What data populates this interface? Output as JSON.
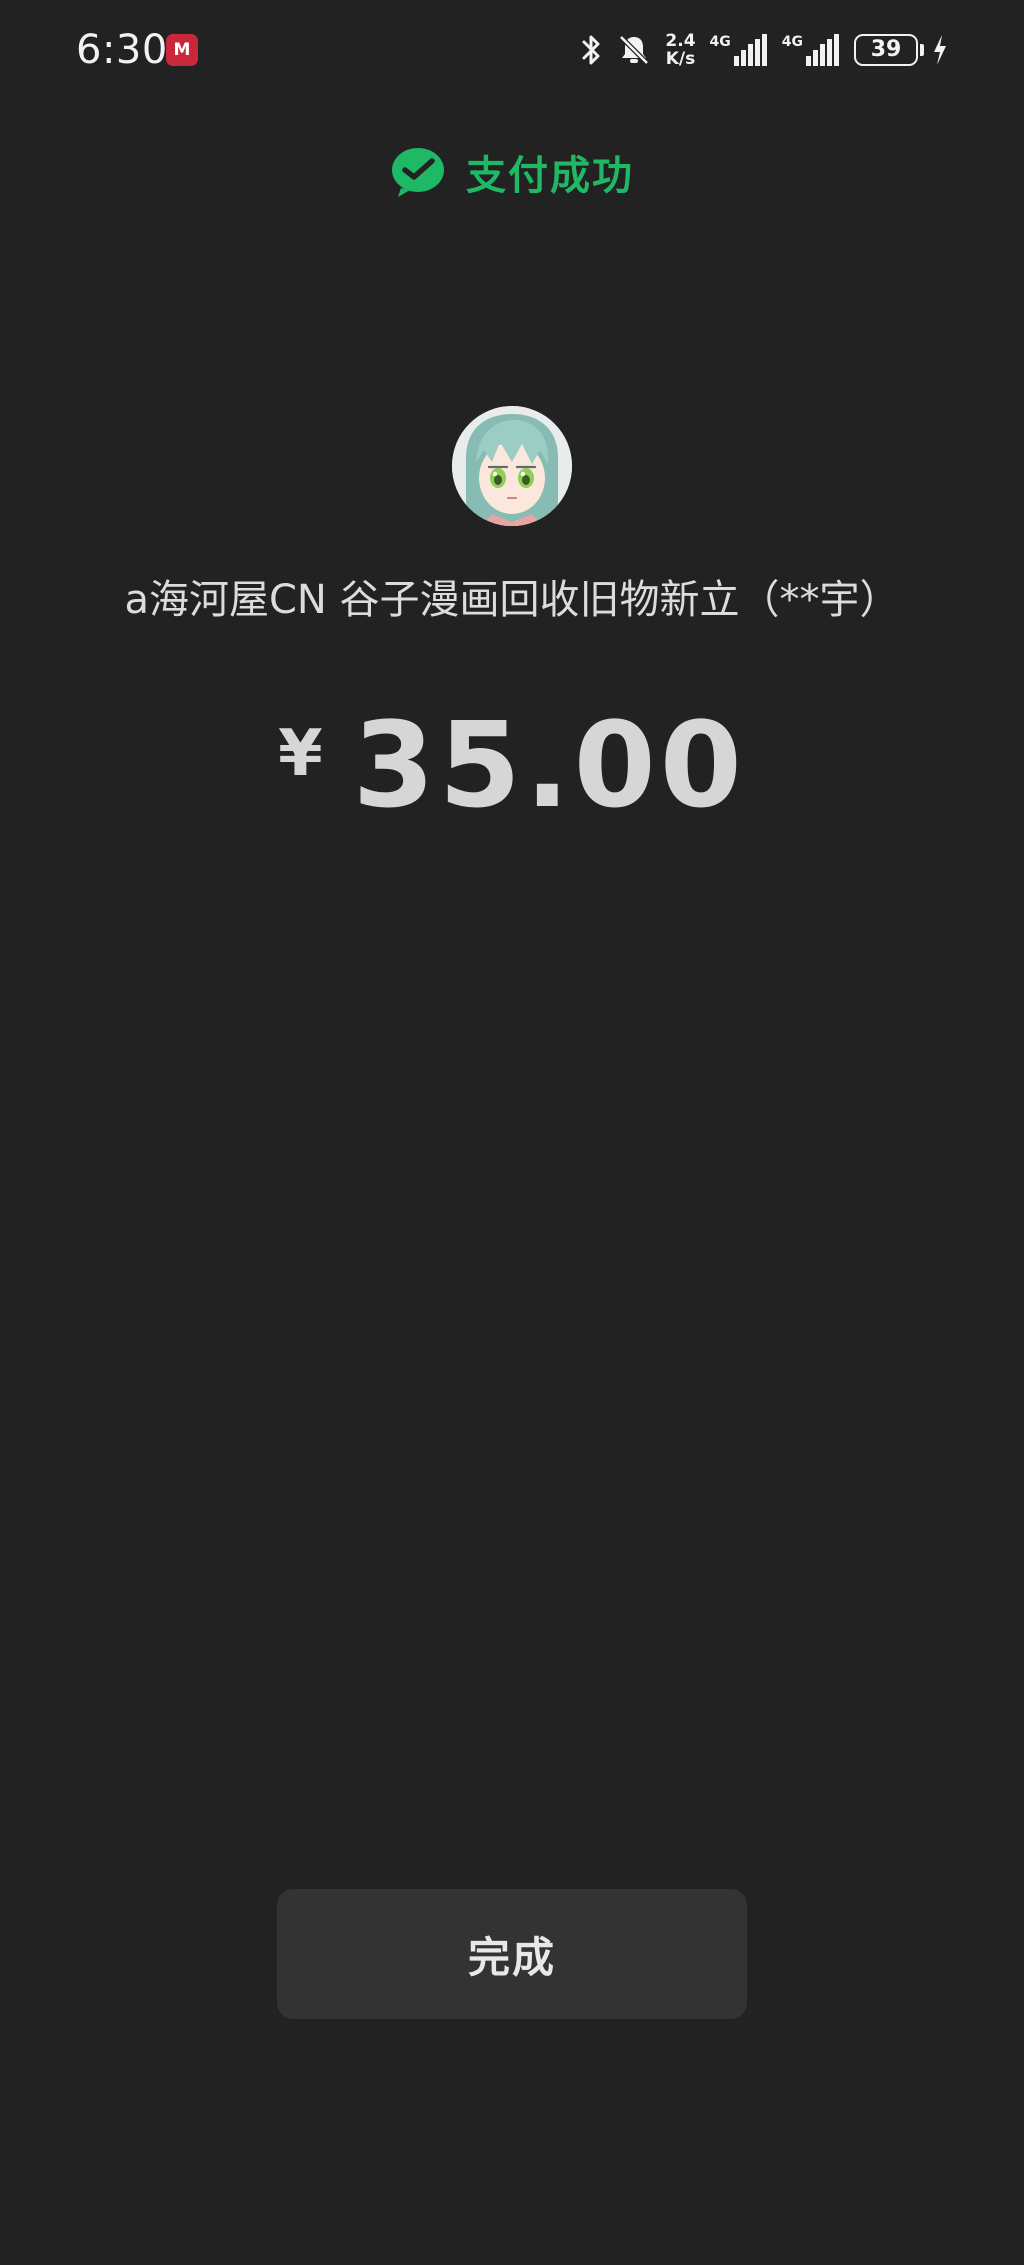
{
  "status_bar": {
    "time": "6:30",
    "app_badge_label": "M",
    "network_speed_value": "2.4",
    "network_speed_unit": "K/s",
    "sim1_tech": "4G",
    "sim2_tech": "4G",
    "battery_level": "39",
    "icons": [
      "bluetooth-icon",
      "bell-off-icon",
      "signal-icon",
      "signal-icon",
      "battery-icon",
      "charging-icon"
    ]
  },
  "header": {
    "status_text": "支付成功",
    "icon": "wechat-pay-check-icon",
    "accent_color": "#1fb865"
  },
  "merchant": {
    "name": "a海河屋CN 谷子漫画回收旧物新立（**宇）",
    "avatar_icon": "anime-character-avatar"
  },
  "payment": {
    "currency_symbol": "¥",
    "amount": "35.00"
  },
  "actions": {
    "done_label": "完成"
  },
  "colors": {
    "background": "#222222",
    "button_background": "#333333"
  }
}
